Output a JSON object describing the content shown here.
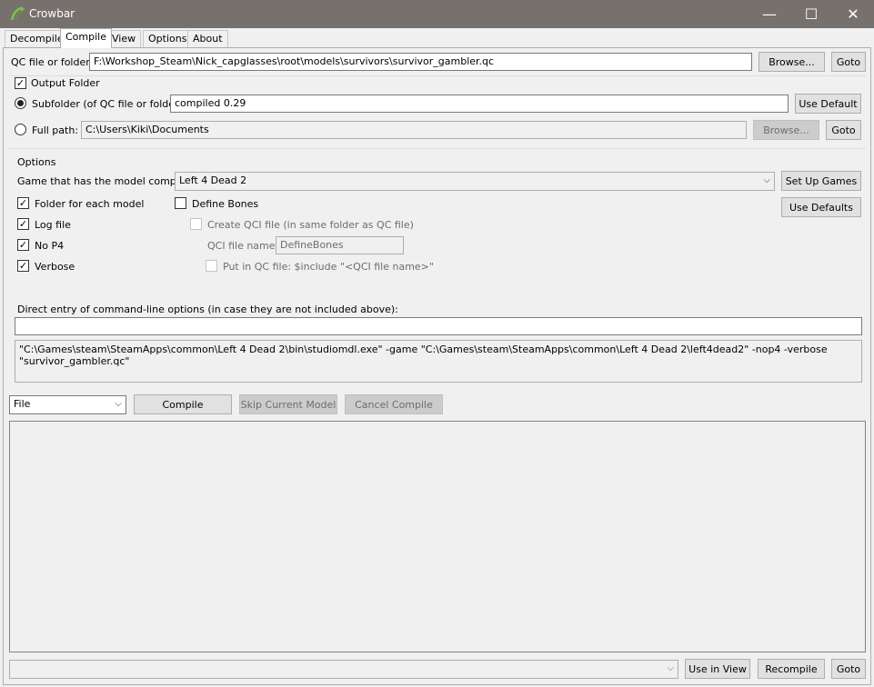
{
  "window": {
    "title": "Crowbar",
    "controls": {
      "minimize": "—",
      "maximize": "☐",
      "close": "✕"
    }
  },
  "tabs": [
    "Decompile",
    "Compile",
    "View",
    "Options",
    "About"
  ],
  "qc": {
    "label": "QC file or folder:",
    "value": "F:\\Workshop_Steam\\Nick_capglasses\\root\\models\\survivors\\survivor_gambler.qc",
    "browse": "Browse...",
    "goto": "Goto"
  },
  "output": {
    "label": "Output Folder",
    "subfolder_label": "Subfolder (of QC file or folder):",
    "subfolder_value": "compiled 0.29",
    "use_default": "Use Default",
    "fullpath_label": "Full path:",
    "fullpath_value": "C:\\Users\\Kiki\\Documents",
    "browse": "Browse...",
    "goto": "Goto"
  },
  "options": {
    "label": "Options",
    "game_label": "Game that has the model compiler:",
    "game_value": "Left 4 Dead 2",
    "setup_games": "Set Up Games",
    "use_defaults": "Use Defaults",
    "folder_each_model": "Folder for each model",
    "define_bones": "Define Bones",
    "log_file": "Log file",
    "create_qci": "Create QCI file (in same folder as QC file)",
    "no_p4": "No P4",
    "qci_name_label": "QCI file name:",
    "qci_name_value": "DefineBones",
    "verbose": "Verbose",
    "put_in_qc": "Put in QC file: $include \"<QCI file name>\""
  },
  "direct": {
    "label": "Direct entry of command-line options (in case they are not included above):",
    "value": "",
    "command": "\"C:\\Games\\steam\\SteamApps\\common\\Left 4 Dead 2\\bin\\studiomdl.exe\" -game \"C:\\Games\\steam\\SteamApps\\common\\Left 4 Dead 2\\left4dead2\" -nop4 -verbose \"survivor_gambler.qc\""
  },
  "actions": {
    "mode": "File",
    "compile": "Compile",
    "skip": "Skip Current Model",
    "cancel": "Cancel Compile"
  },
  "bottom": {
    "dropdown_value": "",
    "use_in_view": "Use in View",
    "recompile": "Recompile",
    "goto": "Goto"
  }
}
